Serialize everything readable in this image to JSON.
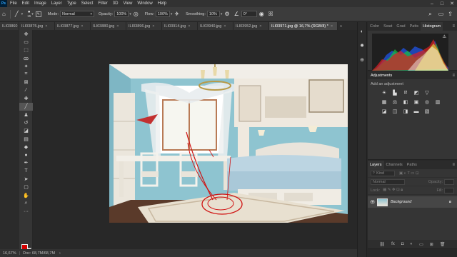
{
  "menu": [
    "File",
    "Edit",
    "Image",
    "Layer",
    "Type",
    "Select",
    "Filter",
    "3D",
    "View",
    "Window",
    "Help"
  ],
  "app": {
    "logo": "Ps",
    "minimize": "–",
    "maximize": "□",
    "close": "✕"
  },
  "options": {
    "brush_size": "15",
    "mode_label": "Mode:",
    "mode_value": "Normal",
    "opacity_label": "Opacity:",
    "opacity_value": "100%",
    "flow_label": "Flow:",
    "flow_value": "100%",
    "smoothing_label": "Smoothing:",
    "smoothing_value": "10%",
    "angle_value": "0°"
  },
  "tabs": [
    {
      "label": "ILI03860"
    },
    {
      "label": "ILI03875.jpg",
      "close": "×"
    },
    {
      "label": "ILI03877.jpg",
      "close": "×"
    },
    {
      "label": "ILI03880.jpg",
      "close": "×"
    },
    {
      "label": "ILI03896.jpg",
      "close": "×"
    },
    {
      "label": "ILI03914.jpg",
      "close": "×"
    },
    {
      "label": "ILI03940.jpg",
      "close": "×"
    },
    {
      "label": "ILI03952.jpg",
      "close": "×"
    },
    {
      "label": "ILI03971.jpg @ 16,7% (RGB/8) *",
      "close": "×"
    }
  ],
  "status": {
    "zoom": "16,67%",
    "doc": "Doc: 68,7M/68,7M",
    "arrow": "›"
  },
  "colors": {
    "foreground": "#d40000",
    "background": "#ffffff",
    "accent": "#31a8ff"
  },
  "histogram_panel": {
    "tabs": [
      "Color",
      "Swat",
      "Grad",
      "Patts",
      "Histogram"
    ],
    "menu": "≡"
  },
  "adjustments_panel": {
    "title": "Adjustments",
    "subtitle": "Add an adjustment",
    "menu": "≡"
  },
  "layers_panel": {
    "tabs": [
      "Layers",
      "Channels",
      "Paths"
    ],
    "menu": "≡",
    "kind_placeholder": "Kind",
    "blend_mode": "Normal",
    "opacity_label": "Opacity:",
    "lock_label": "Lock:",
    "fill_label": "Fill:",
    "layer_name": "Background"
  }
}
